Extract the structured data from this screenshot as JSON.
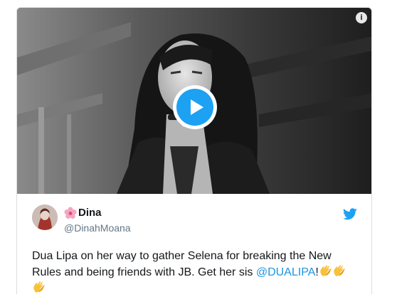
{
  "tweet": {
    "author": {
      "display_name": "Dina",
      "handle": "@DinahMoana"
    },
    "text_before": "Dua Lipa on her way to gather Selena for breaking the New Rules and being friends with JB. Get her sis ",
    "mention": "@DUALIPA",
    "text_after": "!",
    "emoji_icons": [
      "clapping-hands-icon",
      "clapping-hands-icon",
      "clapping-hands-icon"
    ],
    "name_emoji_icon": "cherry-blossom-icon"
  },
  "media": {
    "type": "video",
    "play_icon": "play-icon",
    "info_icon_glyph": "i"
  },
  "colors": {
    "accent": "#1da1f2",
    "mention": "#1b95e0",
    "handle": "#657786",
    "text": "#14171a",
    "border": "#d8dee3"
  }
}
